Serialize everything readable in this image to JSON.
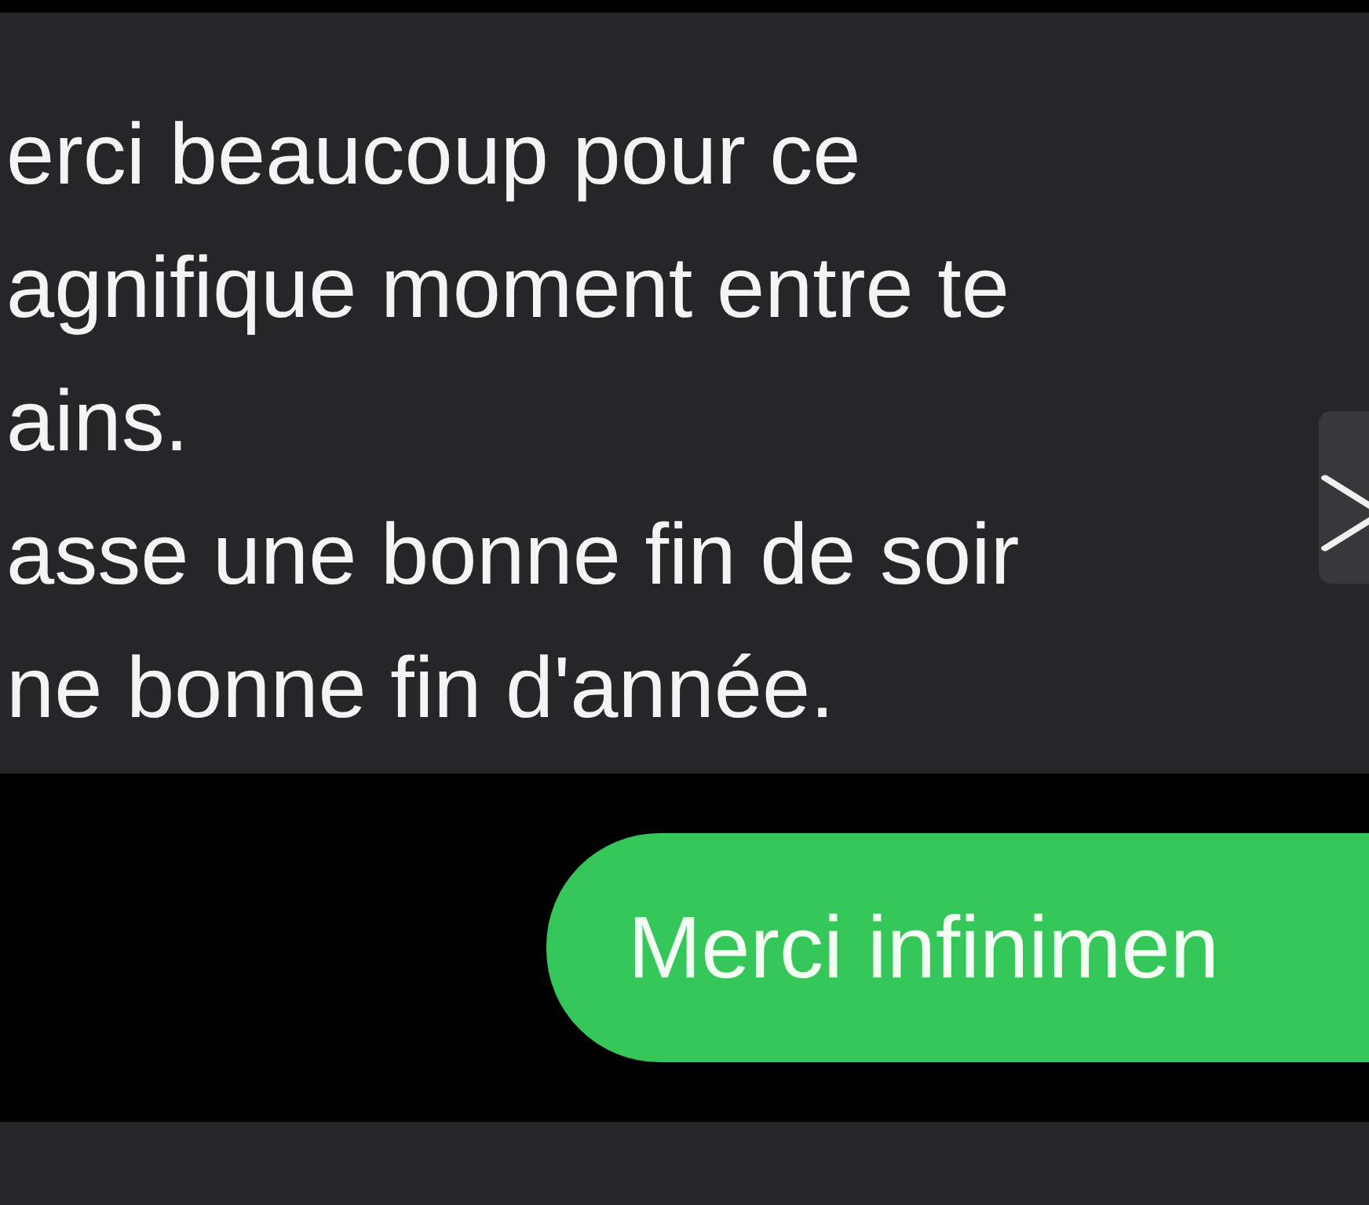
{
  "received_message": {
    "lines": [
      "erci beaucoup pour ce",
      "agnifique moment entre te",
      "ains.",
      "asse une bonne fin de soir",
      "ne bonne fin d'année."
    ]
  },
  "sent_message": {
    "text": "Merci infinimen"
  }
}
